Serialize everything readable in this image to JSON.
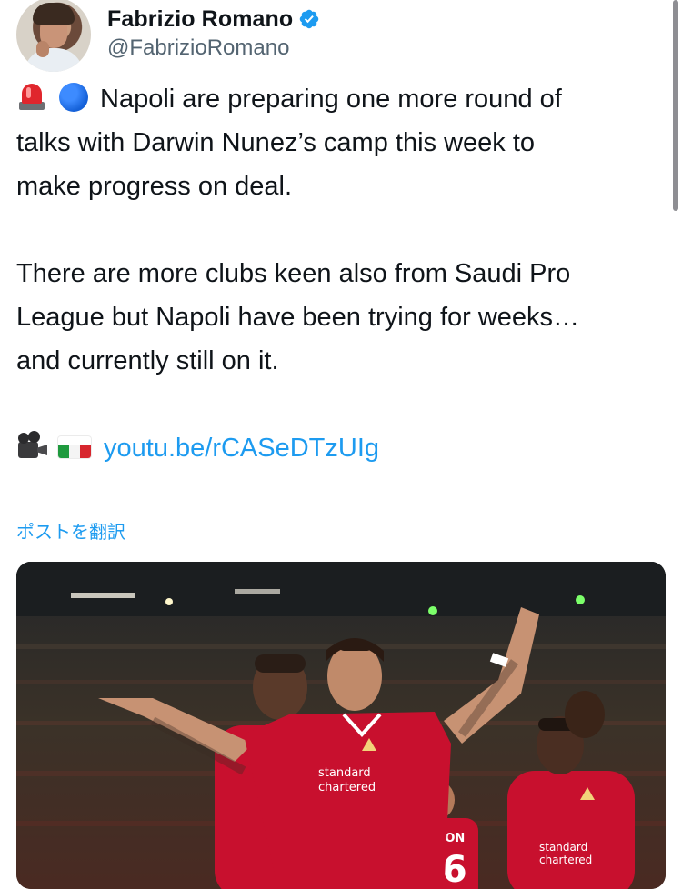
{
  "author": {
    "name": "Fabrizio Romano",
    "handle": "@FabrizioRomano",
    "verified": true,
    "verified_color": "#1d9bf0"
  },
  "tweet": {
    "line1": "Napoli are preparing one more round of",
    "line2": "talks with Darwin Nunez’s camp this week to",
    "line3": "make progress on deal.",
    "line4": "There are more clubs keen also from Saudi Pro",
    "line5": "League but Napoli have been trying for weeks…",
    "line6": "and currently still on it.",
    "link": "youtu.be/rCASeDTzUIg",
    "emojis": [
      "siren-emoji",
      "blue-circle-emoji",
      "movie-camera-emoji",
      "italy-flag-emoji"
    ]
  },
  "translate_label": "ポストを翻訳",
  "media": {
    "sponsor_text_1": "standard",
    "sponsor_text_2": "chartered",
    "sponsor_text_3": "standard",
    "sponsor_text_4": "chartered",
    "shirt_name": "IERTSON",
    "shirt_number": "26"
  },
  "colors": {
    "text": "#0f1419",
    "secondary": "#536471",
    "link": "#1d9bf0",
    "kit_red": "#c8102e"
  }
}
